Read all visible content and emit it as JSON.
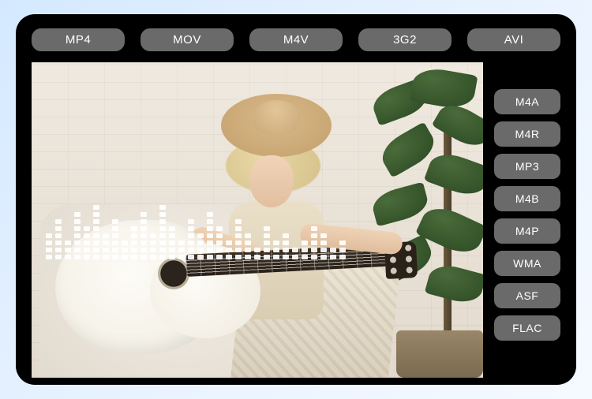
{
  "top_formats": [
    "MP4",
    "MOV",
    "M4V",
    "3G2",
    "AVI"
  ],
  "side_formats": [
    "M4A",
    "M4R",
    "MP3",
    "M4B",
    "M4P",
    "WMA",
    "ASF",
    "FLAC"
  ],
  "equalizer_bars": [
    4,
    6,
    3,
    7,
    5,
    8,
    4,
    6,
    3,
    5,
    7,
    4,
    8,
    5,
    3,
    6,
    4,
    7,
    5,
    3,
    6,
    4,
    2,
    5,
    3,
    4,
    2,
    3,
    5,
    4,
    2,
    3
  ]
}
